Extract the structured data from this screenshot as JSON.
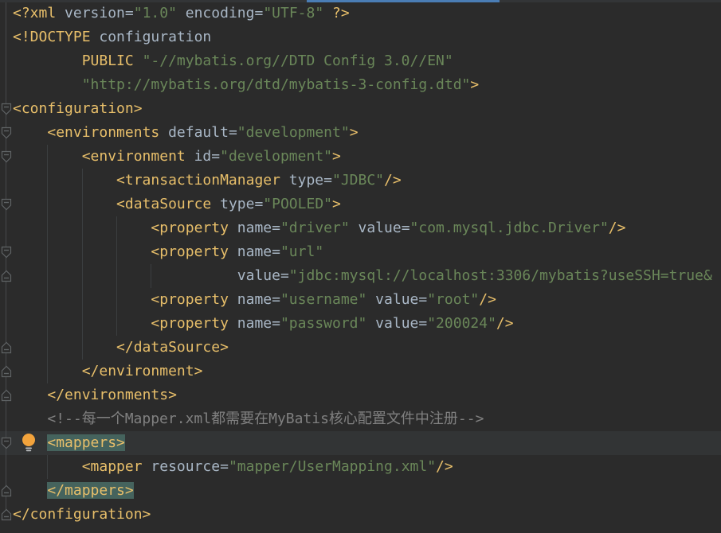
{
  "window": {
    "active_tab_underline_color": "#4a7db5"
  },
  "editor": {
    "background": "#2b2b2b",
    "caret_row_color": "#323435",
    "matched_tag_highlight_color": "#45635d",
    "colors": {
      "tag": "#e8bf6a",
      "attribute": "#a9b7c6",
      "string": "#6a8759",
      "comment": "#808080",
      "indent_guide": "#3b3e40",
      "fold_marker": "#5f6365",
      "bulb": "#f2a33c"
    },
    "caret_line": 19,
    "bulb_line": 19,
    "lines": [
      [
        [
          "tag",
          "<?xml"
        ],
        [
          "attr",
          " version"
        ],
        [
          "p",
          "="
        ],
        [
          "str",
          "\"1.0\""
        ],
        [
          "attr",
          " encoding"
        ],
        [
          "p",
          "="
        ],
        [
          "str",
          "\"UTF-8\""
        ],
        [
          "tag",
          " ?>"
        ]
      ],
      [
        [
          "tag",
          "<!DOCTYPE"
        ],
        [
          "plain",
          " configuration"
        ]
      ],
      [
        [
          "plain",
          "        "
        ],
        [
          "kw",
          "PUBLIC"
        ],
        [
          "str",
          " \"-//mybatis.org//DTD Config 3.0//EN\""
        ]
      ],
      [
        [
          "plain",
          "        "
        ],
        [
          "str",
          "\"http://mybatis.org/dtd/mybatis-3-config.dtd\""
        ],
        [
          "tag",
          ">"
        ]
      ],
      [
        [
          "tag",
          "<configuration>"
        ]
      ],
      [
        [
          "plain",
          "    "
        ],
        [
          "tag",
          "<environments"
        ],
        [
          "attr",
          " default"
        ],
        [
          "p",
          "="
        ],
        [
          "str",
          "\"development\""
        ],
        [
          "tag",
          ">"
        ]
      ],
      [
        [
          "plain",
          "        "
        ],
        [
          "tag",
          "<environment"
        ],
        [
          "attr",
          " id"
        ],
        [
          "p",
          "="
        ],
        [
          "str",
          "\"development\""
        ],
        [
          "tag",
          ">"
        ]
      ],
      [
        [
          "plain",
          "            "
        ],
        [
          "tag",
          "<transactionManager"
        ],
        [
          "attr",
          " type"
        ],
        [
          "p",
          "="
        ],
        [
          "str",
          "\"JDBC\""
        ],
        [
          "tag",
          "/>"
        ]
      ],
      [
        [
          "plain",
          "            "
        ],
        [
          "tag",
          "<dataSource"
        ],
        [
          "attr",
          " type"
        ],
        [
          "p",
          "="
        ],
        [
          "str",
          "\"POOLED\""
        ],
        [
          "tag",
          ">"
        ]
      ],
      [
        [
          "plain",
          "                "
        ],
        [
          "tag",
          "<property"
        ],
        [
          "attr",
          " name"
        ],
        [
          "p",
          "="
        ],
        [
          "str",
          "\"driver\""
        ],
        [
          "attr",
          " value"
        ],
        [
          "p",
          "="
        ],
        [
          "str",
          "\"com.mysql.jdbc.Driver\""
        ],
        [
          "tag",
          "/>"
        ]
      ],
      [
        [
          "plain",
          "                "
        ],
        [
          "tag",
          "<property"
        ],
        [
          "attr",
          " name"
        ],
        [
          "p",
          "="
        ],
        [
          "str",
          "\"url\""
        ]
      ],
      [
        [
          "plain",
          "                          "
        ],
        [
          "attr",
          "value"
        ],
        [
          "p",
          "="
        ],
        [
          "str",
          "\"jdbc:mysql://localhost:3306/mybatis?useSSH=true&"
        ]
      ],
      [
        [
          "plain",
          "                "
        ],
        [
          "tag",
          "<property"
        ],
        [
          "attr",
          " name"
        ],
        [
          "p",
          "="
        ],
        [
          "str",
          "\"username\""
        ],
        [
          "attr",
          " value"
        ],
        [
          "p",
          "="
        ],
        [
          "str",
          "\"root\""
        ],
        [
          "tag",
          "/>"
        ]
      ],
      [
        [
          "plain",
          "                "
        ],
        [
          "tag",
          "<property"
        ],
        [
          "attr",
          " name"
        ],
        [
          "p",
          "="
        ],
        [
          "str",
          "\"password\""
        ],
        [
          "attr",
          " value"
        ],
        [
          "p",
          "="
        ],
        [
          "str",
          "\"200024\""
        ],
        [
          "tag",
          "/>"
        ]
      ],
      [
        [
          "plain",
          "            "
        ],
        [
          "tag",
          "</dataSource>"
        ]
      ],
      [
        [
          "plain",
          "        "
        ],
        [
          "tag",
          "</environment>"
        ]
      ],
      [
        [
          "plain",
          "    "
        ],
        [
          "tag",
          "</environments>"
        ]
      ],
      [
        [
          "plain",
          "    "
        ],
        [
          "comment",
          "<!--每一个Mapper.xml都需要在MyBatis核心配置文件中注册-->"
        ]
      ],
      [
        [
          "plain",
          "    "
        ],
        [
          "taghl",
          "<mappers>"
        ]
      ],
      [
        [
          "plain",
          "        "
        ],
        [
          "tag",
          "<mapper"
        ],
        [
          "attr",
          " resource"
        ],
        [
          "p",
          "="
        ],
        [
          "str",
          "\"mapper/UserMapping.xml\""
        ],
        [
          "tag",
          "/>"
        ]
      ],
      [
        [
          "plain",
          "    "
        ],
        [
          "taghl",
          "</mappers>"
        ]
      ],
      [
        [
          "tag",
          "</configuration>"
        ]
      ]
    ],
    "indent_guides": [
      {
        "col": 4,
        "from": 7,
        "to": 16
      },
      {
        "col": 8,
        "from": 8,
        "to": 15
      },
      {
        "col": 12,
        "from": 10,
        "to": 14
      },
      {
        "col": 16,
        "from": 12,
        "to": 12
      },
      {
        "col": 4,
        "from": 20,
        "to": 20
      }
    ]
  },
  "gutter": {
    "fold_markers": [
      {
        "line": 5,
        "dir": "down"
      },
      {
        "line": 6,
        "dir": "down"
      },
      {
        "line": 7,
        "dir": "down"
      },
      {
        "line": 9,
        "dir": "down"
      },
      {
        "line": 11,
        "dir": "down"
      },
      {
        "line": 12,
        "dir": "up"
      },
      {
        "line": 15,
        "dir": "up"
      },
      {
        "line": 16,
        "dir": "up"
      },
      {
        "line": 17,
        "dir": "up"
      },
      {
        "line": 19,
        "dir": "down"
      },
      {
        "line": 21,
        "dir": "up"
      },
      {
        "line": 22,
        "dir": "up"
      }
    ]
  }
}
